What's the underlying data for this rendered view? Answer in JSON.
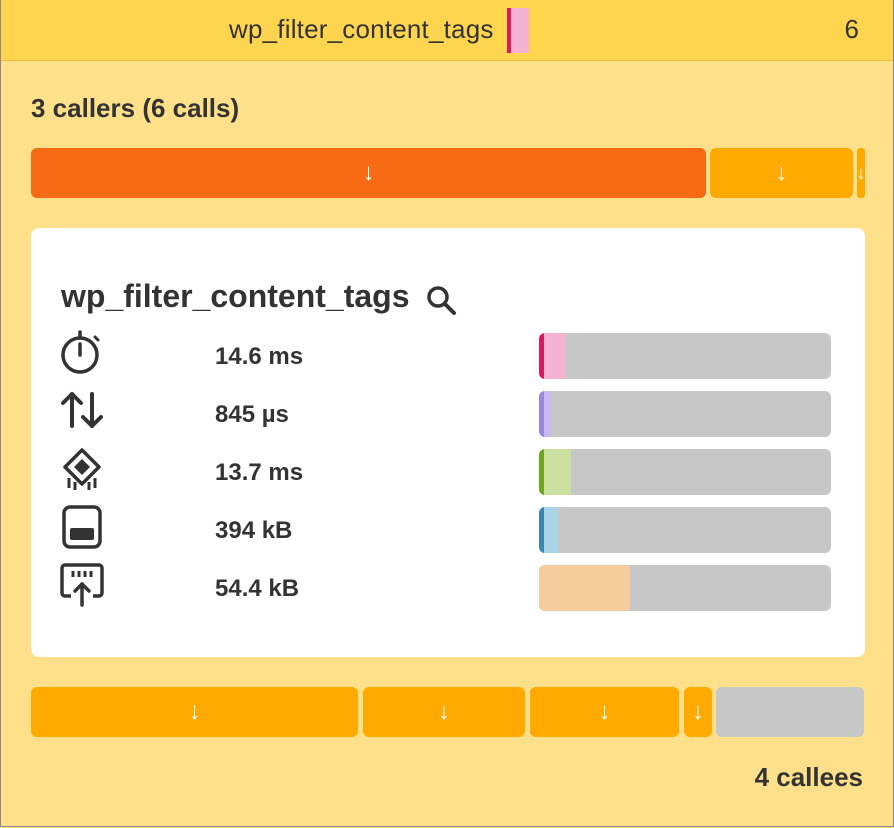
{
  "header": {
    "function_name": "wp_filter_content_tags",
    "call_count": "6",
    "swatch_color": "#f4b3d0",
    "swatch_edge_color": "#d81b60"
  },
  "callers": {
    "heading": "3 callers (6 calls)",
    "segments": [
      {
        "arrow": "↓",
        "color": "#f96a14",
        "share": 0.76
      },
      {
        "arrow": "↓",
        "color": "#ffaa00",
        "share": 0.16
      },
      {
        "arrow": "↓",
        "color": "#ffaa00",
        "share": 0.01
      }
    ]
  },
  "details": {
    "function_name": "wp_filter_content_tags",
    "metrics": [
      {
        "icon": "stopwatch-icon",
        "value": "14.6 ms",
        "fraction": 0.09,
        "fill_color": "#f4b3d0",
        "edge_color": "#d81b60"
      },
      {
        "icon": "io-arrows-icon",
        "value": "845 µs",
        "fraction": 0.04,
        "fill_color": "#c9b8f2",
        "edge_color": "#9a86e0"
      },
      {
        "icon": "cpu-chip-icon",
        "value": "13.7 ms",
        "fraction": 0.11,
        "fill_color": "#cce0a0",
        "edge_color": "#6aa820"
      },
      {
        "icon": "memory-icon",
        "value": "394 kB",
        "fraction": 0.065,
        "fill_color": "#a8d4e6",
        "edge_color": "#3a86b0"
      },
      {
        "icon": "network-upload-icon",
        "value": "54.4 kB",
        "fraction": 0.31,
        "fill_color": "#f5cc9c",
        "edge_color": "#f5cc9c"
      }
    ]
  },
  "callees": {
    "heading": "4 callees",
    "segments": [
      {
        "arrow": "↓",
        "color": "#ffaa00",
        "share": 0.4
      },
      {
        "arrow": "↓",
        "color": "#ffaa00",
        "share": 0.2
      },
      {
        "arrow": "↓",
        "color": "#ffaa00",
        "share": 0.18
      },
      {
        "arrow": "↓",
        "color": "#ffaa00",
        "share": 0.03
      },
      {
        "arrow": "",
        "color": "#c7c7c7",
        "share": 0.19
      }
    ]
  }
}
